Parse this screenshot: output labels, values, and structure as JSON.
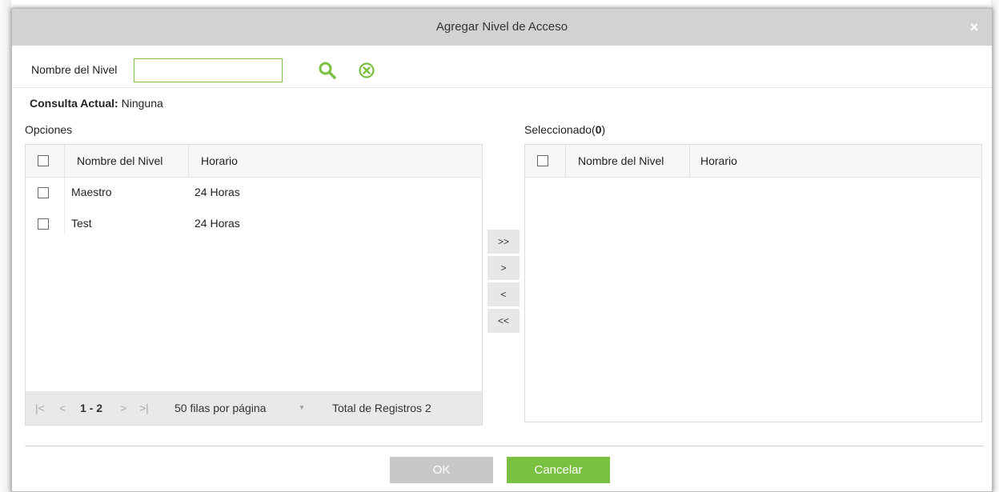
{
  "dialog": {
    "title": "Agregar Nivel de Acceso",
    "close_glyph": "×"
  },
  "search": {
    "label": "Nombre del Nivel",
    "value": "",
    "placeholder": ""
  },
  "query": {
    "label": "Consulta Actual:",
    "value": "Ninguna"
  },
  "options_panel": {
    "title": "Opciones",
    "columns": [
      "Nombre del Nivel",
      "Horario"
    ],
    "rows": [
      {
        "name": "Maestro",
        "schedule": "24 Horas"
      },
      {
        "name": "Test",
        "schedule": "24 Horas"
      }
    ],
    "pager": {
      "first": "|<",
      "prev": "<",
      "range": "1 - 2",
      "next": ">",
      "last": ">|",
      "per_page": "50 filas por página",
      "dropdown_glyph": "▼",
      "total": "Total de Registros 2"
    }
  },
  "selected_panel": {
    "title_prefix": "Seleccionado(",
    "count": "0",
    "title_suffix": ")",
    "columns": [
      "Nombre del Nivel",
      "Horario"
    ]
  },
  "transfer": {
    "add_all": ">>",
    "add_one": ">",
    "remove_one": "<",
    "remove_all": "<<"
  },
  "actions": {
    "ok": "OK",
    "cancel": "Cancelar"
  },
  "colors": {
    "accent_green": "#7ac142",
    "titlebar_gray": "#d2d2d2",
    "ok_disabled": "#c8c8c8"
  },
  "icons": [
    "search-icon",
    "clear-icon",
    "close-icon"
  ]
}
